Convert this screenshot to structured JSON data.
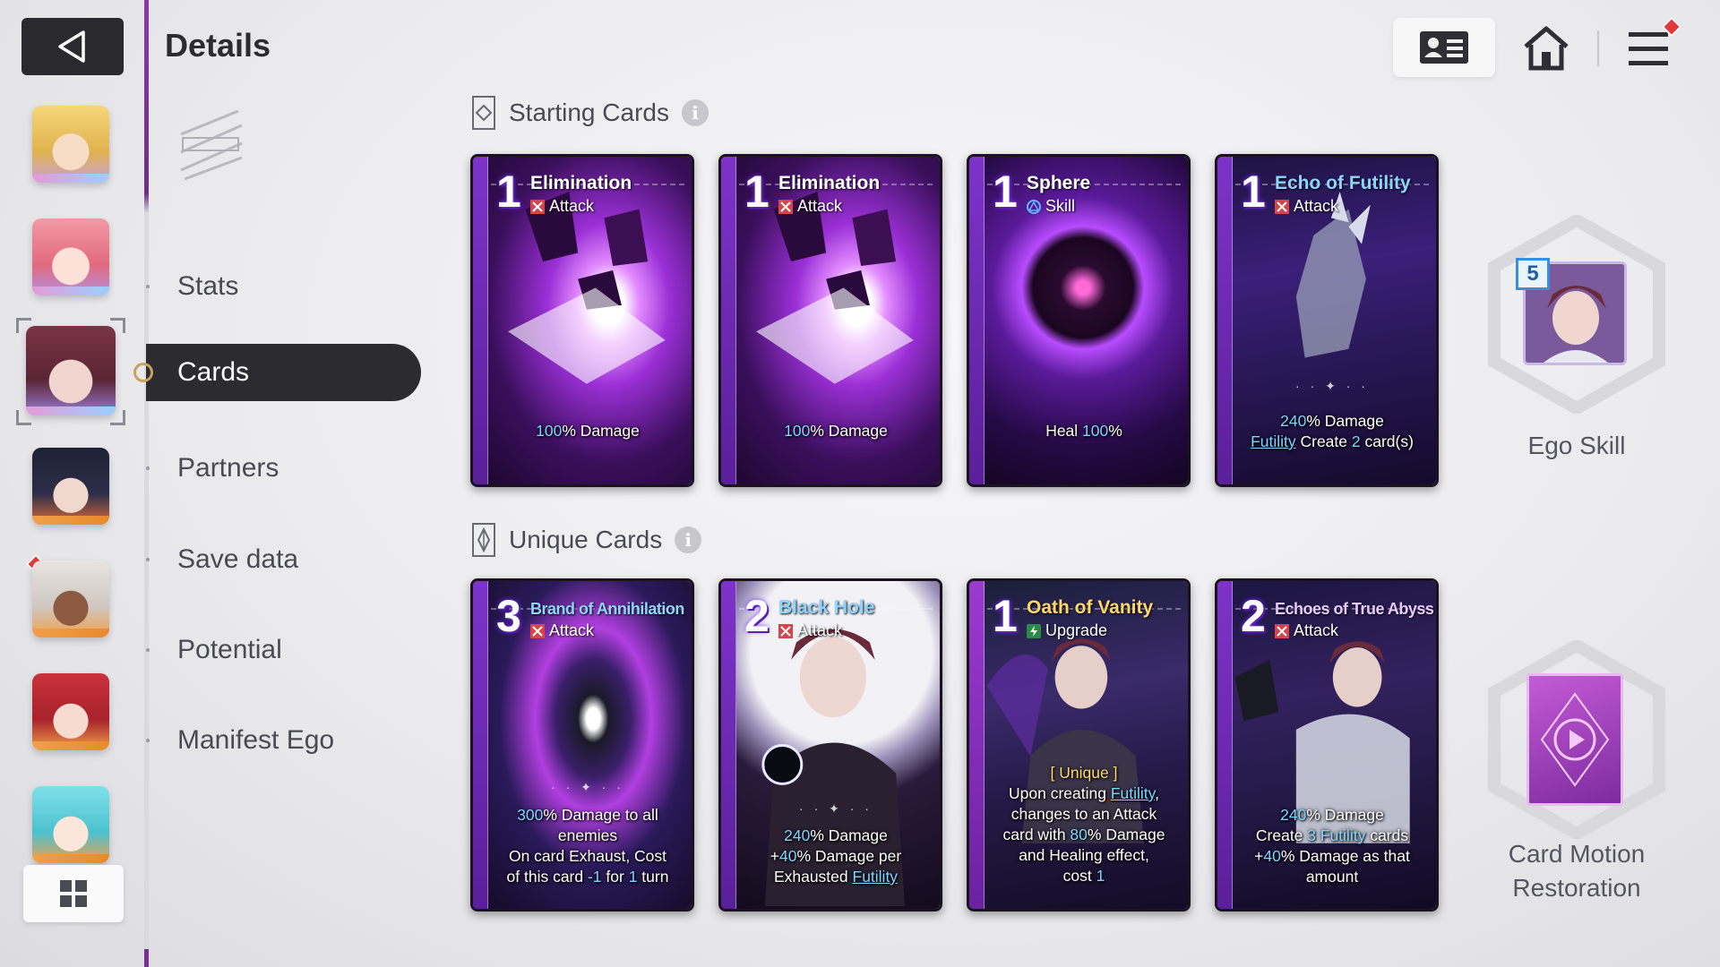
{
  "header": {
    "title": "Details"
  },
  "nav": {
    "items": [
      {
        "label": "Stats",
        "active": false
      },
      {
        "label": "Cards",
        "active": true
      },
      {
        "label": "Partners",
        "active": false
      },
      {
        "label": "Save data",
        "active": false
      },
      {
        "label": "Potential",
        "active": false
      },
      {
        "label": "Manifest Ego",
        "active": false
      }
    ]
  },
  "characters": [
    {
      "id": "blonde",
      "selected": false,
      "alert": false
    },
    {
      "id": "pink",
      "selected": false,
      "alert": false
    },
    {
      "id": "maroon-hair",
      "selected": true,
      "alert": false
    },
    {
      "id": "dark-hair",
      "selected": false,
      "alert": false
    },
    {
      "id": "white-hair",
      "selected": false,
      "alert": true
    },
    {
      "id": "red-hair",
      "selected": false,
      "alert": false
    },
    {
      "id": "teal-hair",
      "selected": false,
      "alert": false
    }
  ],
  "sections": {
    "starting": {
      "title": "Starting Cards"
    },
    "unique": {
      "title": "Unique Cards"
    }
  },
  "starting_cards": [
    {
      "cost": "1",
      "name": "Elimination",
      "type": "Attack",
      "desc_pre": "",
      "desc_num": "100",
      "desc_post": "% Damage"
    },
    {
      "cost": "1",
      "name": "Elimination",
      "type": "Attack",
      "desc_pre": "",
      "desc_num": "100",
      "desc_post": "% Damage"
    },
    {
      "cost": "1",
      "name": "Sphere",
      "type": "Skill",
      "desc_pre": "Heal ",
      "desc_num": "100",
      "desc_post": "%"
    },
    {
      "cost": "1",
      "name": "Echo of Futility",
      "type": "Attack",
      "line1_num": "240",
      "line1_post": "% Damage",
      "line2_kw": "Futility",
      "line2_mid": " Create ",
      "line2_num": "2",
      "line2_post": " card(s)"
    }
  ],
  "unique_cards": [
    {
      "cost": "3",
      "name": "Brand of Annihilation",
      "type": "Attack",
      "l1_num": "300",
      "l1_post": "% Damage to all",
      "l2": "enemies",
      "l3": "On card Exhaust, Cost",
      "l4_pre": "of this card ",
      "l4_num": "-1",
      "l4_mid": " for ",
      "l4_num2": "1",
      "l4_post": " turn"
    },
    {
      "cost": "2",
      "name": "Black Hole",
      "type": "Attack",
      "l1_num": "240",
      "l1_post": "% Damage",
      "l2_pre": "+",
      "l2_num": "40",
      "l2_post": "% Damage per",
      "l3_pre": "Exhausted ",
      "l3_kw": "Futility"
    },
    {
      "cost": "1",
      "name": "Oath of Vanity",
      "type": "Upgrade",
      "tag": "[ Unique ]",
      "l1_pre": "Upon creating ",
      "l1_kw": "Futility",
      "l1_post": ",",
      "l2": "changes to an Attack",
      "l3_pre": "card with ",
      "l3_num": "80",
      "l3_post": "% Damage",
      "l4": "and Healing effect,",
      "l5_pre": "cost ",
      "l5_num": "1"
    },
    {
      "cost": "2",
      "name": "Echoes of True Abyss",
      "type": "Attack",
      "l1_num": "240",
      "l1_post": "% Damage",
      "l2_pre": "Create ",
      "l2_num": "3",
      "l2_kw": " Futility",
      "l2_post": " cards",
      "l3_pre": "+",
      "l3_num": "40",
      "l3_post": "% Damage as that",
      "l4": "amount"
    }
  ],
  "ego_skill": {
    "level": "5",
    "label": "Ego Skill"
  },
  "card_motion": {
    "line1": "Card Motion",
    "line2": "Restoration"
  },
  "icons": {
    "back": "back-arrow-icon",
    "grid": "grid-icon",
    "profile": "id-card-icon",
    "home": "home-icon",
    "menu": "hamburger-menu-icon",
    "info": "info-icon"
  },
  "colors": {
    "accent_purple": "#7d33c9",
    "highlight_blue": "#7fd4ff",
    "alert_red": "#e23a3a",
    "active_nav": "#2c2c30"
  }
}
